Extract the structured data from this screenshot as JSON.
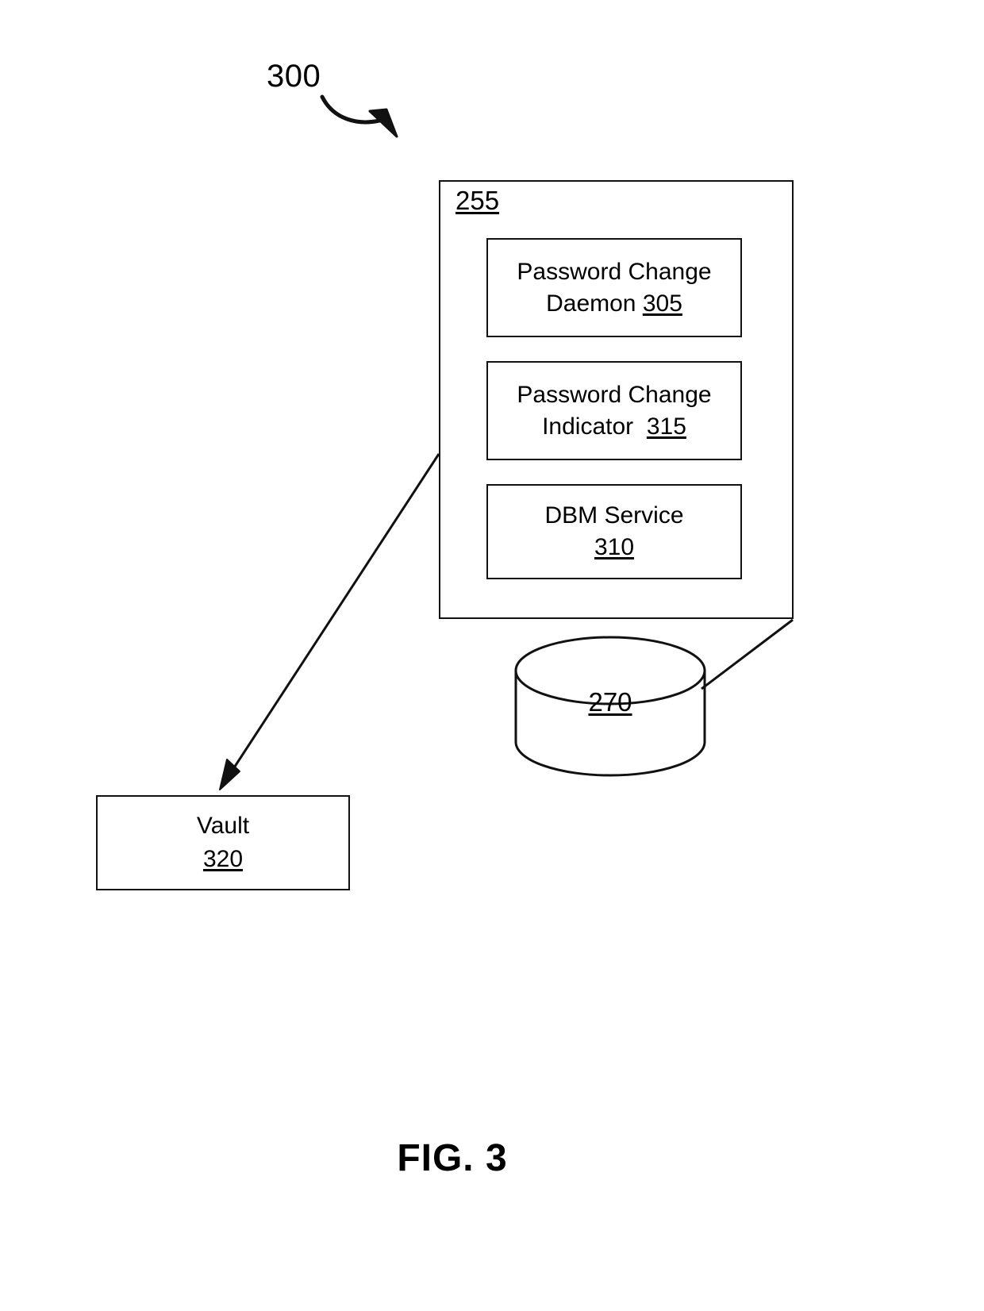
{
  "figure": {
    "caption": "FIG. 3",
    "diagram_ref": "300"
  },
  "outer_container": {
    "ref": "255"
  },
  "components": [
    {
      "name": "password-change-daemon",
      "line1": "Password Change",
      "line2_text": "Daemon ",
      "line2_ref": "305"
    },
    {
      "name": "password-change-indicator",
      "line1": "Password Change",
      "line2_text": "Indicator ",
      "line2_ref": "315"
    },
    {
      "name": "dbm-service",
      "line1": "DBM Service",
      "line2_text": "",
      "line2_ref": "310"
    }
  ],
  "database": {
    "name": "database-cylinder",
    "ref": "270"
  },
  "vault": {
    "name": "vault",
    "label": "Vault",
    "ref": "320"
  },
  "colors": {
    "stroke": "#111111",
    "background": "#ffffff"
  }
}
